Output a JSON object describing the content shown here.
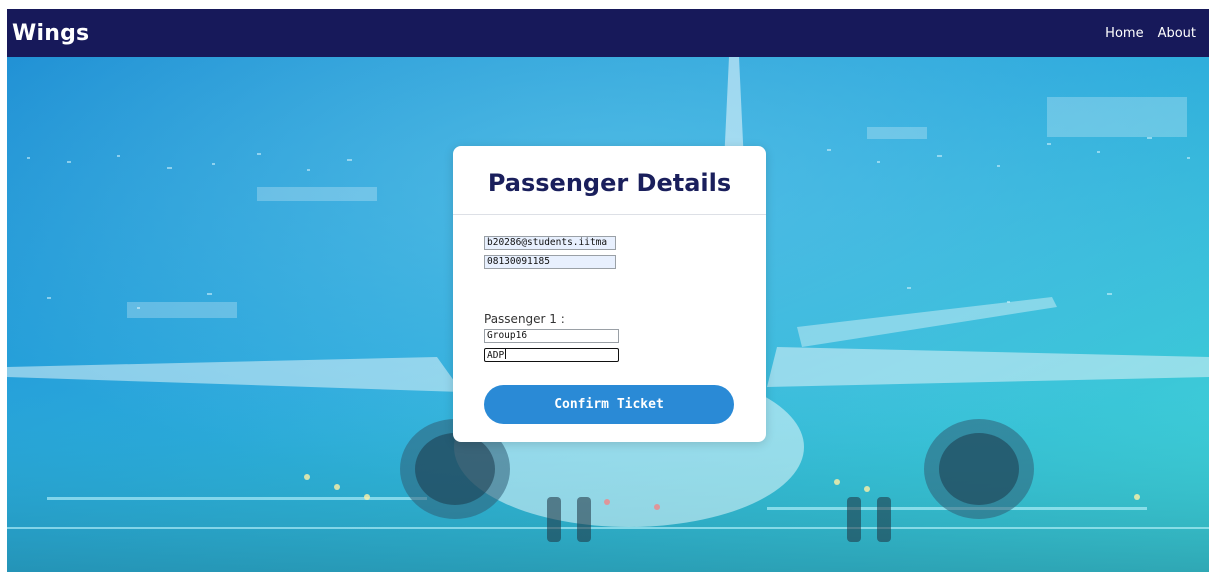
{
  "navbar": {
    "brand": "Wings",
    "links": [
      "Home",
      "About"
    ]
  },
  "card": {
    "title": "Passenger Details",
    "contact": {
      "email": "b20286@students.iitma",
      "phone": "08130091185"
    },
    "passenger_label": "Passenger 1 :",
    "passenger": {
      "name": "Group16",
      "detail": "ADP"
    },
    "confirm_label": "Confirm Ticket"
  },
  "colors": {
    "navbar": "#17195a",
    "title": "#1a1f5c",
    "button": "#2a8ad6",
    "autofill": "#e8f0fe"
  }
}
